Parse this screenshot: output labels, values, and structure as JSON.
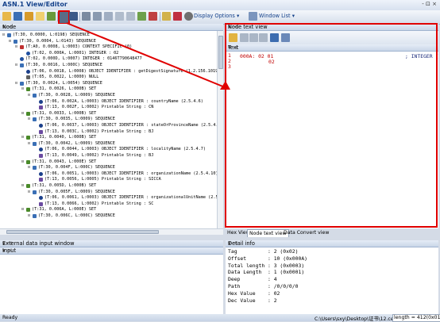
{
  "app": {
    "title": "ASN.1 View/Editor",
    "window_controls": "- ⊡ ×"
  },
  "toolbar": {
    "display_options": "Display Options",
    "window_list": "Window List"
  },
  "node_panel": {
    "title": "Node",
    "rows": [
      {
        "indent": 0,
        "toggle": "⊟",
        "icon": "seq",
        "text": "(T:30, 0.0000, L:0198) SEQUENCE"
      },
      {
        "indent": 1,
        "toggle": "⊟",
        "icon": "seq",
        "text": "(T:30, 0.0004, L:0143) SEQUENCE"
      },
      {
        "indent": 2,
        "toggle": "⊟",
        "icon": "ctx",
        "text": "(T:A0, 0.0008, L:0003) CONTEXT SPECIFIC (0)"
      },
      {
        "indent": 3,
        "toggle": "",
        "icon": "int",
        "text": "(T:02, 0.000A, L:0001) INTEGER : 02"
      },
      {
        "indent": 2,
        "toggle": "",
        "icon": "int",
        "text": "(T:02, 0.000D, L:0007) INTEGER : 0146T790648477"
      },
      {
        "indent": 2,
        "toggle": "⊟",
        "icon": "seq",
        "text": "(T:30, 0.0016, L:000C) SEQUENCE"
      },
      {
        "indent": 3,
        "toggle": "",
        "icon": "oid",
        "text": "(T:06, 0.0018, L:0008) OBJECT IDENTIFIER : getDigestSignature (1.2.156.10197.1.501)"
      },
      {
        "indent": 3,
        "toggle": "",
        "icon": "nul",
        "text": "(T:05, 0.0022, L:0000) NULL"
      },
      {
        "indent": 2,
        "toggle": "⊟",
        "icon": "seq",
        "text": "(T:30, 0.0024, L:0054) SEQUENCE"
      },
      {
        "indent": 3,
        "toggle": "⊟",
        "icon": "set",
        "text": "(T:31, 0.0026, L:000B) SET"
      },
      {
        "indent": 4,
        "toggle": "⊟",
        "icon": "seq",
        "text": "(T:30, 0.0028, L:0009) SEQUENCE"
      },
      {
        "indent": 5,
        "toggle": "",
        "icon": "oid",
        "text": "(T:06, 0.002A, L:0003) OBJECT IDENTIFIER : countryName (2.5.4.6)"
      },
      {
        "indent": 5,
        "toggle": "",
        "icon": "str",
        "text": "(T:13, 0.002F, L:0002) Printable String : CN"
      },
      {
        "indent": 3,
        "toggle": "⊟",
        "icon": "set",
        "text": "(T:31, 0.0033, L:000B) SET"
      },
      {
        "indent": 4,
        "toggle": "⊟",
        "icon": "seq",
        "text": "(T:30, 0.0035, L:0009) SEQUENCE"
      },
      {
        "indent": 5,
        "toggle": "",
        "icon": "oid",
        "text": "(T:06, 0.0037, L:0003) OBJECT IDENTIFIER : stateOrProvinceName (2.5.4.8)"
      },
      {
        "indent": 5,
        "toggle": "",
        "icon": "str",
        "text": "(T:13, 0.003C, L:0002) Printable String : BJ"
      },
      {
        "indent": 3,
        "toggle": "⊟",
        "icon": "set",
        "text": "(T:31, 0.0040, L:000B) SET"
      },
      {
        "indent": 4,
        "toggle": "⊟",
        "icon": "seq",
        "text": "(T:30, 0.0042, L:0009) SEQUENCE"
      },
      {
        "indent": 5,
        "toggle": "",
        "icon": "oid",
        "text": "(T:06, 0.0044, L:0003) OBJECT IDENTIFIER : localityName (2.5.4.7)"
      },
      {
        "indent": 5,
        "toggle": "",
        "icon": "str",
        "text": "(T:13, 0.0049, L:0002) Printable String : BJ"
      },
      {
        "indent": 3,
        "toggle": "⊟",
        "icon": "set",
        "text": "(T:31, 0.0043, L:000E) SET"
      },
      {
        "indent": 4,
        "toggle": "⊟",
        "icon": "seq",
        "text": "(T:30, 0.004F, L:000C) SEQUENCE"
      },
      {
        "indent": 5,
        "toggle": "",
        "icon": "oid",
        "text": "(T:06, 0.0051, L:0003) OBJECT IDENTIFIER : organizationName (2.5.4.10)"
      },
      {
        "indent": 5,
        "toggle": "",
        "icon": "str",
        "text": "(T:13, 0.0056, L:0005) Printable String : SICCA"
      },
      {
        "indent": 3,
        "toggle": "⊟",
        "icon": "set",
        "text": "(T:31, 0.005D, L:000B) SET"
      },
      {
        "indent": 4,
        "toggle": "⊟",
        "icon": "seq",
        "text": "(T:30, 0.005F, L:0009) SEQUENCE"
      },
      {
        "indent": 5,
        "toggle": "",
        "icon": "oid",
        "text": "(T:06, 0.0061, L:0003) OBJECT IDENTIFIER : organizationalUnitName (2.5.4.11)"
      },
      {
        "indent": 5,
        "toggle": "",
        "icon": "str",
        "text": "(T:13, 0.0066, L:0002) Printable String : SC"
      },
      {
        "indent": 3,
        "toggle": "⊟",
        "icon": "set",
        "text": "(T:31, 0.006A, L:000E) SET"
      },
      {
        "indent": 4,
        "toggle": "⊟",
        "icon": "seq",
        "text": "(T:30, 0.006C, L:000C) SEQUENCE"
      }
    ]
  },
  "node_text_view": {
    "title": "Node text view",
    "text_header": "Text",
    "line_numbers": [
      "1",
      "2",
      "3"
    ],
    "line1": "000A: 02 01",
    "line1_right": "; INTEGER (",
    "line2": "02"
  },
  "right_tabs": [
    "Hex View",
    "Node text view",
    "Data Convert view"
  ],
  "external_panel": {
    "title": "External data input window",
    "input_header": "Input"
  },
  "detail_panel": {
    "title": "Detail info",
    "fields": [
      {
        "label": "Tag",
        "value": ": 2 (0x02)"
      },
      {
        "label": "Offset",
        "value": ": 10 (0x000A)"
      },
      {
        "label": "Total length",
        "value": ": 3 (0x0003)"
      },
      {
        "label": "Data Length",
        "value": ": 1 (0x0001)"
      },
      {
        "label": "Deep",
        "value": ": 4"
      },
      {
        "label": "Path",
        "value": ": /0/0/0/0"
      },
      {
        "label": "Hex Value",
        "value": ": 02"
      },
      {
        "label": "Dec Value",
        "value": ": 2"
      }
    ]
  },
  "status": {
    "left": "Ready",
    "path": "C:\\Users\\sxy\\Desktop\\证书\\12.cer",
    "length": "length = 412(0x019c)"
  },
  "colors": {
    "highlight_red": "#e00000",
    "accent": "#15428b"
  }
}
